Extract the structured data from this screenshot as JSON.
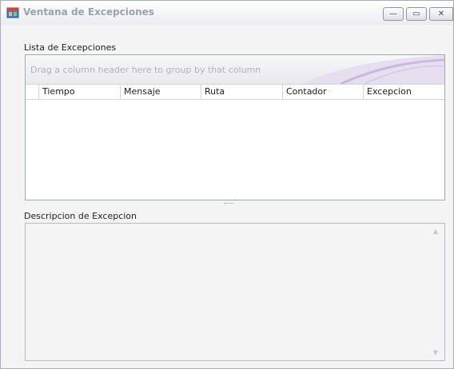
{
  "window": {
    "title": "Ventana de Excepciones"
  },
  "window_buttons": {
    "minimize": "—",
    "maximize": "▭",
    "close": "✕"
  },
  "exceptions": {
    "label": "Lista de Excepciones",
    "group_panel_text": "Drag a column header here to group by that column",
    "columns": [
      "Tiempo",
      "Mensaje",
      "Ruta",
      "Contador",
      "Excepcion"
    ]
  },
  "description": {
    "label": "Descripcion de Excepcion"
  },
  "icons": {
    "scroll_up": "▲",
    "scroll_down": "▼"
  }
}
